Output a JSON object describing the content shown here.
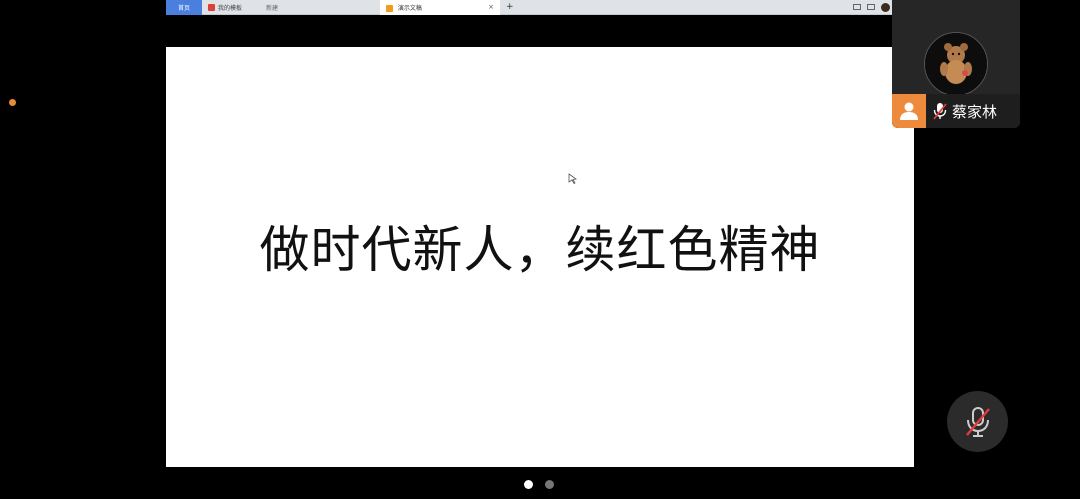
{
  "shared_screen": {
    "tabs": [
      {
        "label": "首页",
        "state": "home"
      },
      {
        "label": "我的模板",
        "state": "inactive",
        "icon": "wps-red-icon"
      },
      {
        "label": "新建",
        "state": "inactive"
      },
      {
        "label": "演示文稿",
        "state": "active",
        "icon": "presentation-orange-icon",
        "close": "×"
      }
    ],
    "new_tab_label": "+",
    "slide": {
      "title": "做时代新人，续红色精神"
    }
  },
  "participant": {
    "name": "蔡家林",
    "mic_state": "muted"
  },
  "controls": {
    "mic_button_state": "muted"
  },
  "pager": {
    "pages": 2,
    "current": 1
  },
  "colors": {
    "accent_orange": "#ee8a3c",
    "tab_home_blue": "#4a7fe0",
    "mute_red": "#e23b3b"
  }
}
